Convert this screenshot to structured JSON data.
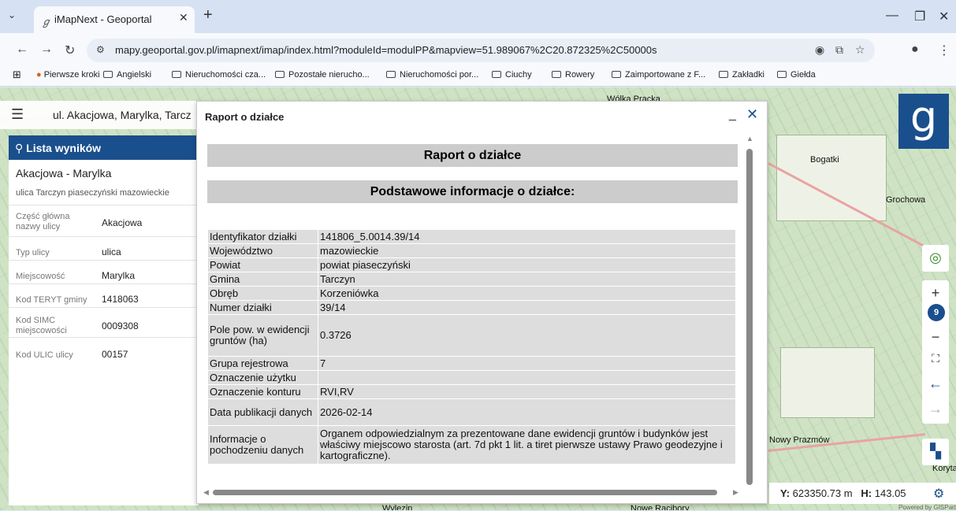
{
  "browser": {
    "tab_title": "iMapNext - Geoportal",
    "url": "mapy.geoportal.gov.pl/imapnext/imap/index.html?moduleId=modulPP&mapview=51.989067%2C20.872325%2C50000s",
    "bookmarks": [
      "Pierwsze kroki",
      "Angielski",
      "Nieruchomości cza...",
      "Pozostałe nierucho...",
      "Nieruchomości por...",
      "Ciuchy",
      "Rowery",
      "Zaimportowane z F...",
      "Zakładki",
      "Giełda"
    ]
  },
  "search": {
    "query": "ul. Akacjowa, Marylka, Tarcz"
  },
  "results": {
    "header": "Lista wyników",
    "name": "Akacjowa - Marylka",
    "subtitle": "ulica Tarczyn piaseczyński mazowieckie",
    "attributes": [
      {
        "label": "Część główna nazwy ulicy",
        "value": "Akacjowa"
      },
      {
        "label": "Typ ulicy",
        "value": "ulica"
      },
      {
        "label": "Miejscowość",
        "value": "Marylka"
      },
      {
        "label": "Kod TERYT gminy",
        "value": "1418063"
      },
      {
        "label": "Kod SIMC miejscowości",
        "value": "0009308"
      },
      {
        "label": "Kod ULIC ulicy",
        "value": "00157"
      }
    ]
  },
  "dialog": {
    "title": "Raport o działce",
    "heading": "Raport o działce",
    "section": "Podstawowe informacje o działce:",
    "rows": [
      {
        "key": "Identyfikator działki",
        "value": "141806_5.0014.39/14"
      },
      {
        "key": "Województwo",
        "value": "mazowieckie"
      },
      {
        "key": "Powiat",
        "value": "powiat piaseczyński"
      },
      {
        "key": "Gmina",
        "value": "Tarczyn"
      },
      {
        "key": "Obręb",
        "value": "Korzeniówka"
      },
      {
        "key": "Numer działki",
        "value": "39/14"
      },
      {
        "key": "Pole pow. w ewidencji gruntów (ha)",
        "value": "0.3726"
      },
      {
        "key": "Grupa rejestrowa",
        "value": "7"
      },
      {
        "key": "Oznaczenie użytku",
        "value": ""
      },
      {
        "key": "Oznaczenie konturu",
        "value": "RVI,RV"
      },
      {
        "key": "Data publikacji danych",
        "value": "2026-02-14"
      },
      {
        "key": "Informacje o pochodzeniu danych",
        "value": "Organem odpowiedzialnym za prezentowane dane ewidencji gruntów i budynków jest właściwy miejscowo starosta (art. 7d pkt 1 lit. a tiret pierwsze ustawy Prawo geodezyjne i kartograficzne)."
      }
    ]
  },
  "map": {
    "labels": [
      "Wólka Pracka",
      "Bogatki",
      "Grochowa",
      "Nowy Prazmów",
      "Koryta",
      "Wylezin",
      "Nowe Racibory"
    ],
    "zoom_level": "9",
    "coords_y_label": "Y:",
    "coords_y": "623350.73 m",
    "coords_h_label": "H:",
    "coords_h": "143.05",
    "credit": "Powered by GISPartner"
  },
  "colors": {
    "brand": "#1a4f8d",
    "tabbar": "#d6e2f3"
  }
}
